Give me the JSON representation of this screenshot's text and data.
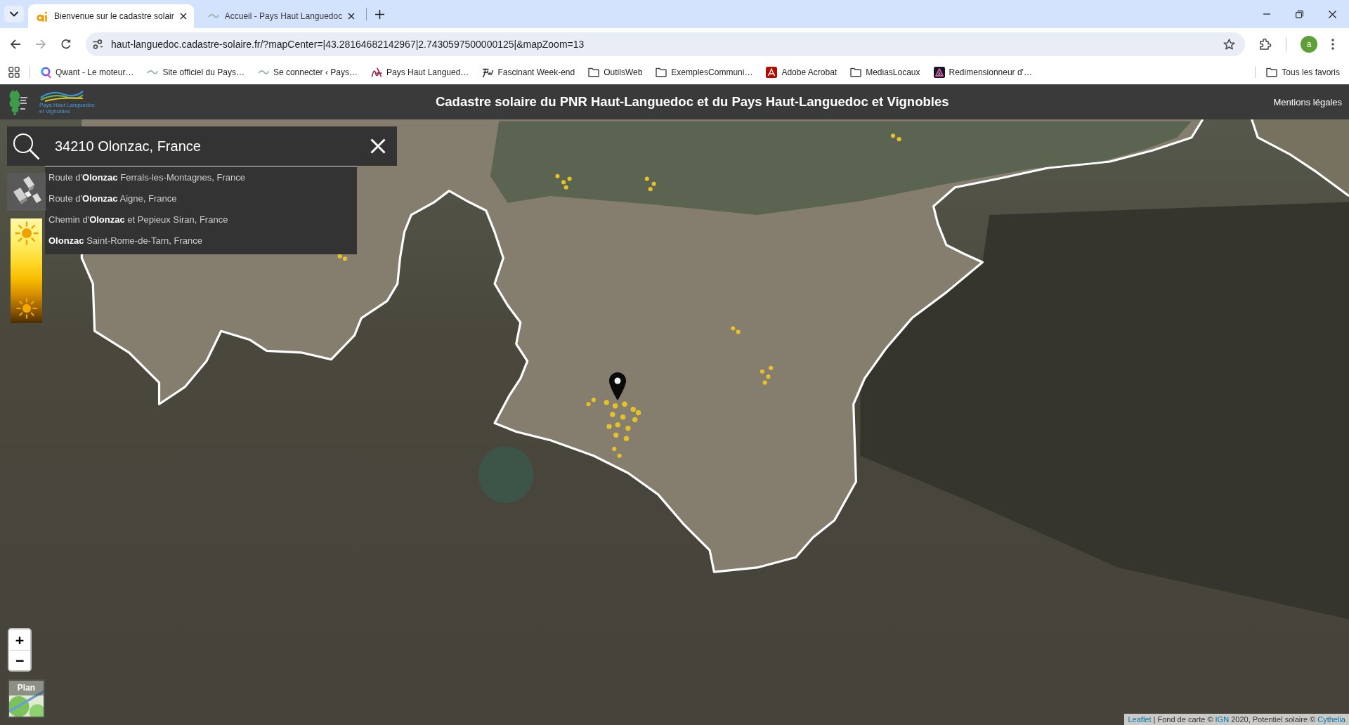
{
  "browser": {
    "tabs": [
      {
        "title": "Bienvenue sur le cadastre solair",
        "selected": true
      },
      {
        "title": "Accueil - Pays Haut Languedoc",
        "selected": false
      }
    ],
    "url": "haut-languedoc.cadastre-solaire.fr/?mapCenter=|43.28164682142967|2.7430597500000125|&mapZoom=13",
    "forward_button": {
      "disabled": true
    },
    "profile_initial": "a",
    "bookmarks": [
      {
        "label": "Qwant - Le moteur…",
        "kind": "site"
      },
      {
        "label": "Site officiel du Pays…",
        "kind": "site"
      },
      {
        "label": "Se connecter ‹ Pays…",
        "kind": "site"
      },
      {
        "label": "Pays Haut Langued…",
        "kind": "site"
      },
      {
        "label": "Fascinant Week-end",
        "kind": "site"
      },
      {
        "label": "OutilsWeb",
        "kind": "folder"
      },
      {
        "label": "ExemplesCommuni…",
        "kind": "folder"
      },
      {
        "label": "Adobe Acrobat",
        "kind": "site"
      },
      {
        "label": "MediasLocaux",
        "kind": "folder"
      },
      {
        "label": "Redimensionneur d'…",
        "kind": "site"
      }
    ],
    "all_bookmarks": "Tous les favoris"
  },
  "header": {
    "logo_lines": [
      "Pays Haut Languedoc",
      "et Vignobles"
    ],
    "title": "Cadastre solaire du PNR Haut-Languedoc et du Pays Haut-Languedoc et Vignobles",
    "legal_link": "Mentions légales"
  },
  "search": {
    "value": "34210 Olonzac, France",
    "suggestions": [
      "Route d'**Olonzac** Ferrals-les-Montagnes, France",
      "Route d'**Olonzac** Aigne, France",
      "Chemin d'**Olonzac** et Pepieux Siran, France",
      "**Olonzac** Saint-Rome-de-Tarn, France"
    ]
  },
  "map_controls": {
    "zoom_in": "+",
    "zoom_out": "−",
    "layer_label": "Plan"
  },
  "attribution": [
    {
      "text": "Leaflet",
      "kind": "link"
    },
    {
      "text": " | Fond de carte © ",
      "kind": "text"
    },
    {
      "text": "IGN",
      "kind": "link"
    },
    {
      "text": " 2020, Potentiel solaire © ",
      "kind": "text"
    },
    {
      "text": "Cythelia",
      "kind": "link"
    }
  ]
}
